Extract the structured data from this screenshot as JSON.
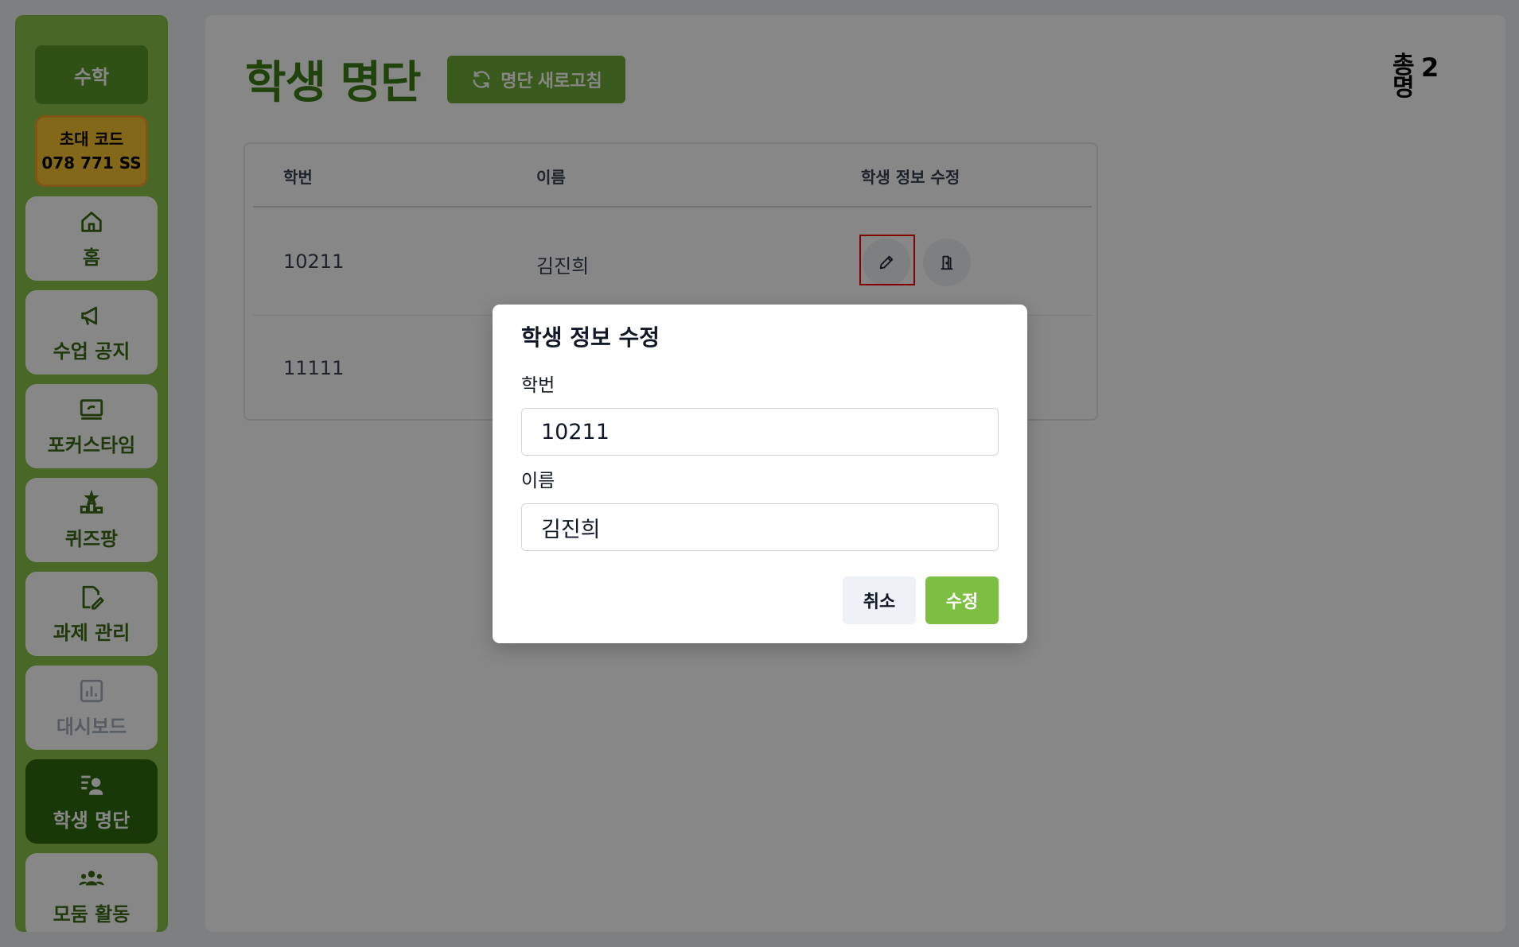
{
  "sidebar": {
    "subject": "수학",
    "invite_label": "초대 코드",
    "invite_code": "078 771 SS",
    "items": [
      {
        "label": "홈",
        "icon": "home-icon"
      },
      {
        "label": "수업 공지",
        "icon": "megaphone-icon"
      },
      {
        "label": "포커스타임",
        "icon": "screen-icon"
      },
      {
        "label": "퀴즈팡",
        "icon": "podium-icon"
      },
      {
        "label": "과제 관리",
        "icon": "assignment-edit-icon"
      },
      {
        "label": "대시보드",
        "icon": "chart-icon"
      },
      {
        "label": "학생 명단",
        "icon": "student-list-icon"
      },
      {
        "label": "모둠 활동",
        "icon": "group-icon"
      }
    ]
  },
  "header": {
    "title": "학생 명단",
    "refresh_label": "명단 새로고침",
    "total_word": "총명",
    "total_count": "2"
  },
  "table": {
    "columns": [
      "학번",
      "이름",
      "학생 정보 수정"
    ],
    "rows": [
      {
        "id": "10211",
        "name": "김진희"
      },
      {
        "id": "11111",
        "name": ""
      }
    ]
  },
  "modal": {
    "title": "학생 정보 수정",
    "id_label": "학번",
    "id_value": "10211",
    "name_label": "이름",
    "name_value": "김진희",
    "cancel_label": "취소",
    "submit_label": "수정"
  },
  "colors": {
    "sidebar_bg": "#8bc34a",
    "accent": "#3e7d16",
    "active_nav": "#2f6b10",
    "submit": "#7cbf43"
  }
}
